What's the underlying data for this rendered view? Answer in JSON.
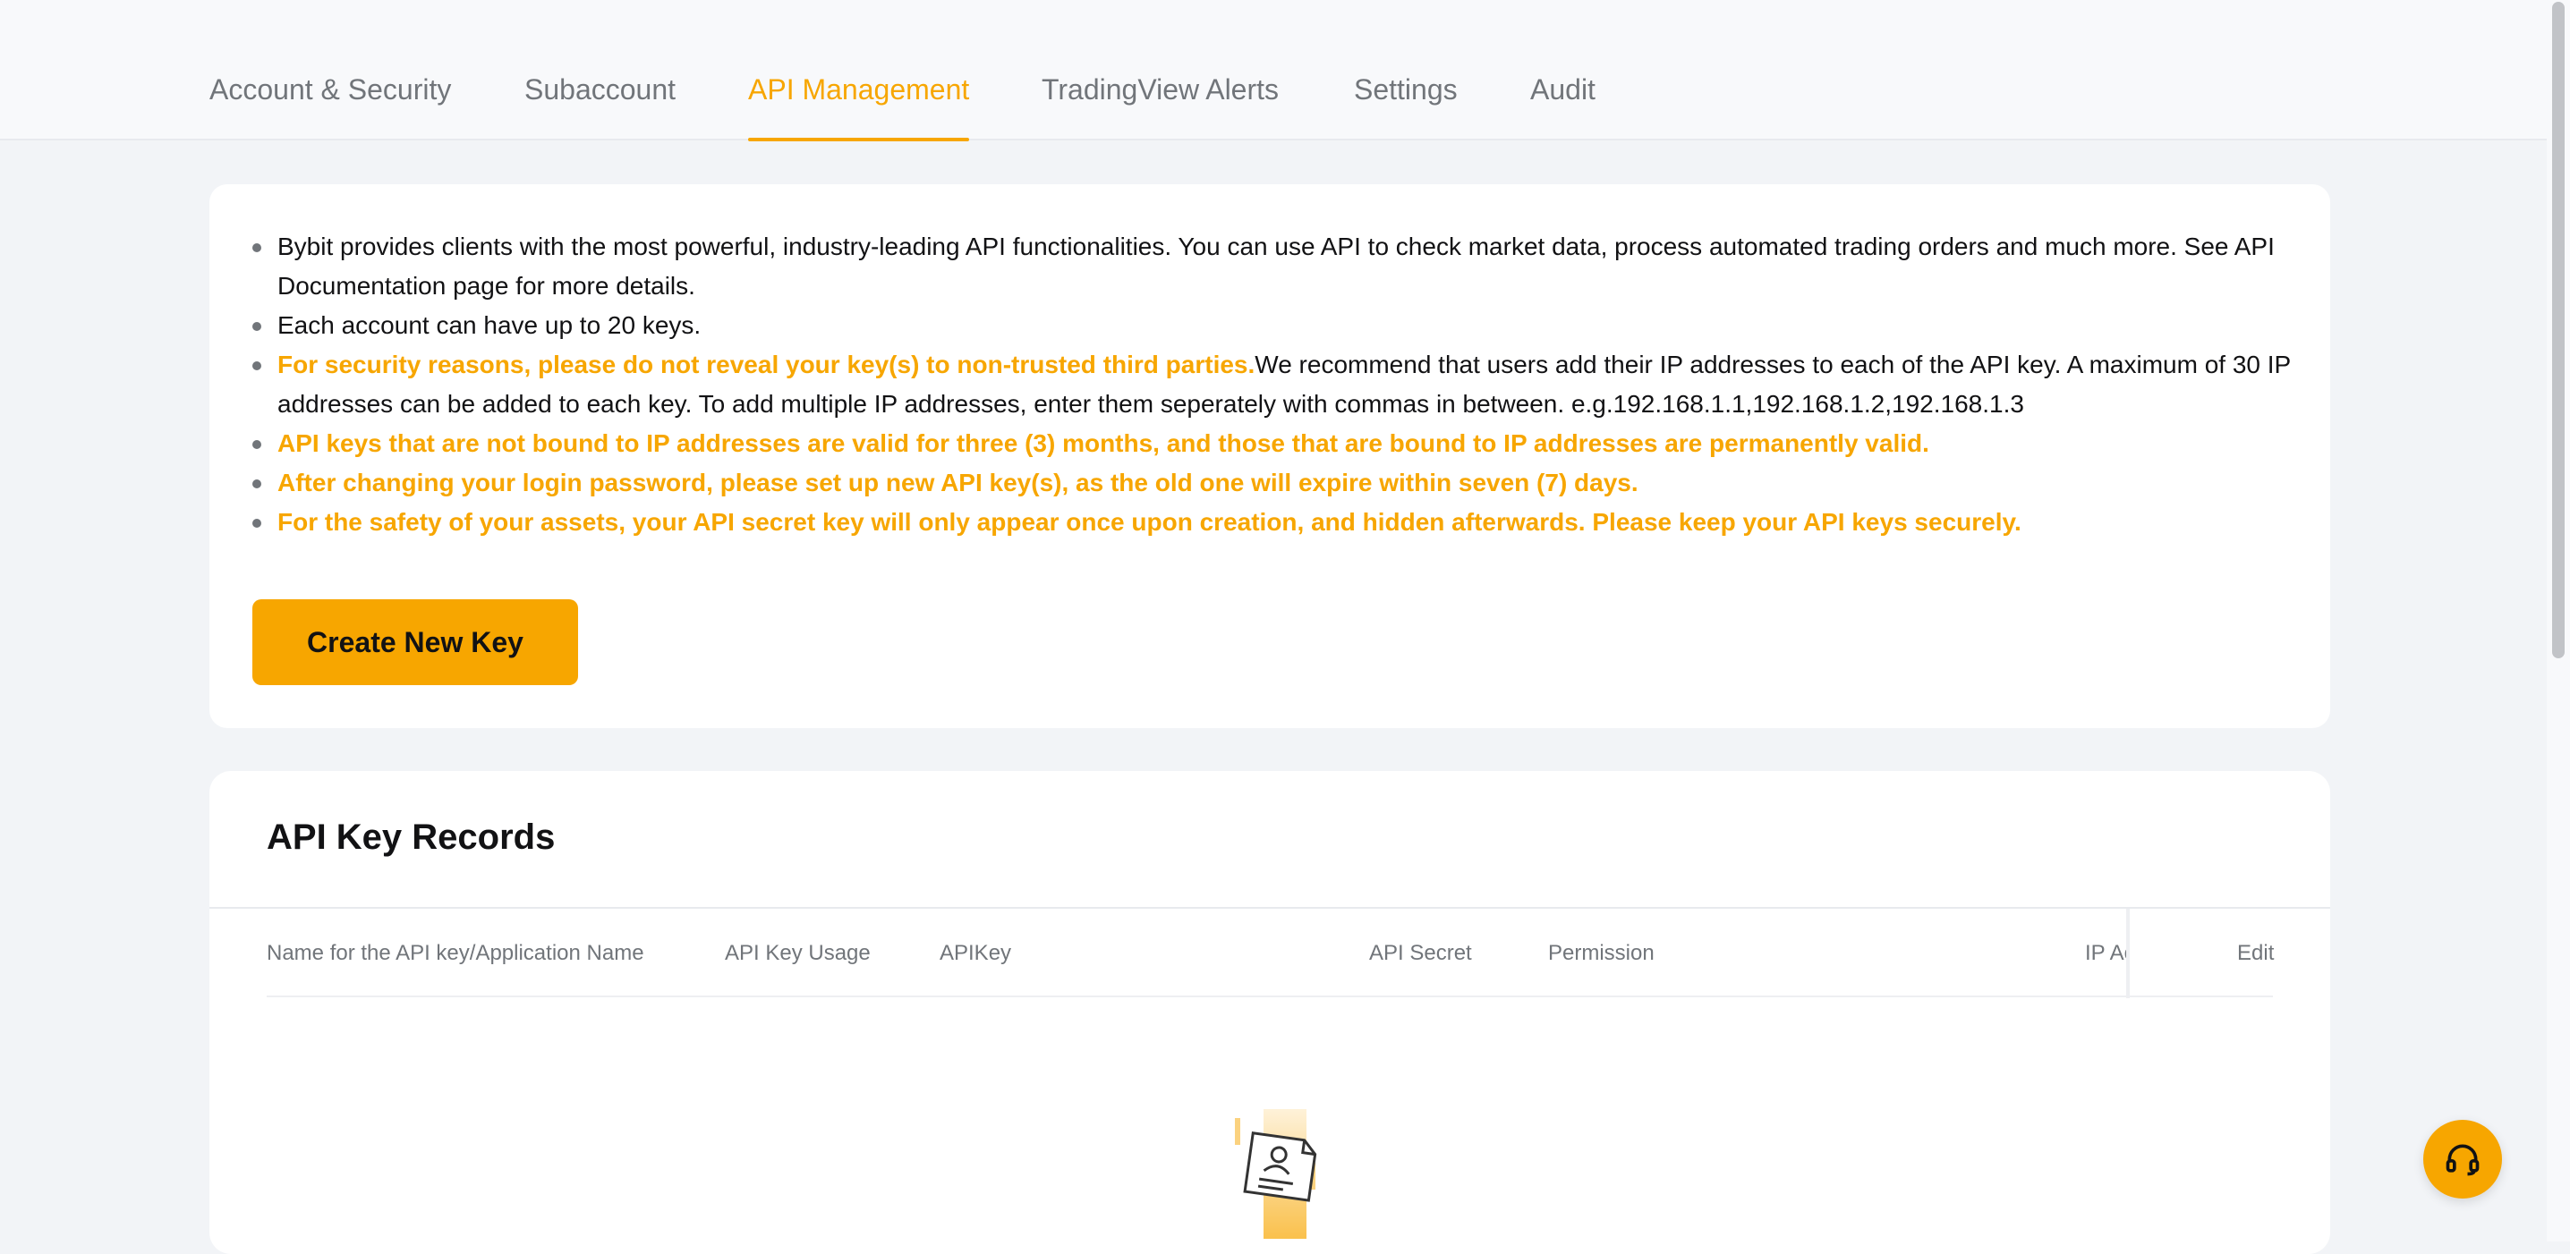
{
  "tabs": [
    {
      "label": "Account & Security",
      "active": false
    },
    {
      "label": "Subaccount",
      "active": false
    },
    {
      "label": "API Management",
      "active": true
    },
    {
      "label": "TradingView Alerts",
      "active": false
    },
    {
      "label": "Settings",
      "active": false
    },
    {
      "label": "Audit",
      "active": false
    }
  ],
  "notes": {
    "item1": "Bybit provides clients with the most powerful, industry-leading API functionalities. You can use API to check market data, process automated trading orders and much more. See API Documentation page for more details.",
    "item2": "Each account can have up to 20 keys.",
    "item3_highlight": "For security reasons, please do not reveal your key(s) to non-trusted third parties.",
    "item3_rest": "We recommend that users add their IP addresses to each of the API key. A maximum of 30 IP addresses can be added to each key. To add multiple IP addresses, enter them seperately with commas in between. e.g.192.168.1.1,192.168.1.2,192.168.1.3",
    "item4": "API keys that are not bound to IP addresses are valid for three (3) months, and those that are bound to IP addresses are permanently valid.",
    "item5": "After changing your login password, please set up new API key(s), as the old one will expire within seven (7) days.",
    "item6": "For the safety of your assets, your API secret key will only appear once upon creation, and hidden afterwards. Please keep your API keys securely."
  },
  "create_button": "Create New Key",
  "records": {
    "title": "API Key Records",
    "columns": {
      "name": "Name for the API key/Application Name",
      "usage": "API Key Usage",
      "apikey": "APIKey",
      "secret": "API Secret",
      "permission": "Permission",
      "ip": "IP Ac",
      "edit": "Edit"
    }
  },
  "colors": {
    "accent": "#f7a600",
    "text_primary": "#121214",
    "text_secondary": "#71757a",
    "page_bg": "#f2f4f7"
  },
  "icons": {
    "empty_state": "empty-document-illustration",
    "support": "headset-icon"
  }
}
